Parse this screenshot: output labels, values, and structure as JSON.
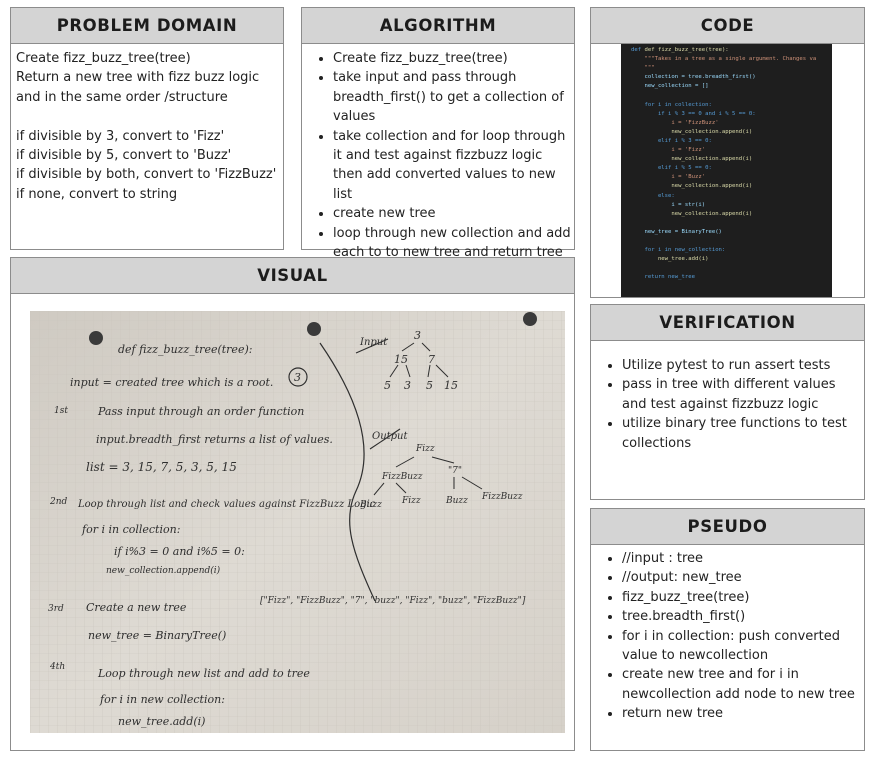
{
  "problem_domain": {
    "title": "PROBLEM DOMAIN",
    "lines": [
      "Create fizz_buzz_tree(tree)",
      "Return a new tree with fizz buzz logic",
      "and in the same order /structure",
      "",
      "if divisible by 3, convert to 'Fizz'",
      "if divisible by 5, convert to 'Buzz'",
      "if divisible by both, convert to 'FizzBuzz'",
      "if none, convert to string"
    ]
  },
  "algorithm": {
    "title": "ALGORITHM",
    "items": [
      "Create fizz_buzz_tree(tree)",
      "take input and pass through breadth_first() to get a collection of values",
      "take collection and for loop through it and test against fizzbuzz logic then add converted values to new list",
      "create new tree",
      "loop through new collection and add each to to new tree and return tree"
    ]
  },
  "code": {
    "title": "CODE",
    "lines": [
      "def fizz_buzz_tree(tree):",
      "    \"\"\"Takes in a tree as a single argument. Changes va",
      "    \"\"\"",
      "    collection = tree.breadth_first()",
      "    new_collection = []",
      "",
      "    for i in collection:",
      "        if i % 3 == 0 and i % 5 == 0:",
      "            i = 'FizzBuzz'",
      "            new_collection.append(i)",
      "        elif i % 3 == 0:",
      "            i = 'Fizz'",
      "            new_collection.append(i)",
      "        elif i % 5 == 0:",
      "            i = 'Buzz'",
      "            new_collection.append(i)",
      "        else:",
      "            i = str(i)",
      "            new_collection.append(i)",
      "",
      "    new_tree = BinaryTree()",
      "",
      "    for i in new_collection:",
      "        new_tree.add(i)",
      "",
      "    return new_tree"
    ]
  },
  "verification": {
    "title": "VERIFICATION",
    "items": [
      "Utilize pytest to run assert tests",
      "pass in tree with different values and test against fizzbuzz logic",
      "utilize binary tree functions to test collections"
    ]
  },
  "pseudo": {
    "title": "PSEUDO",
    "items": [
      "//input : tree",
      "//output: new_tree",
      "fizz_buzz_tree(tree)",
      "tree.breadth_first()",
      "for i in collection: push converted value to newcollection",
      "create new tree and for i in newcollection add node to new tree",
      "return new tree"
    ]
  },
  "visual": {
    "title": "VISUAL",
    "notes": [
      "def fizz_buzz_tree(tree):",
      "input = created tree which is a root.",
      "3",
      "1st",
      "Pass input through an order function",
      "input.breadth_first returns a list of values.",
      "list = 3, 15, 7, 5, 3, 5, 15",
      "2nd",
      "Loop through list and check values against FizzBuzz Logic",
      "for i in collection:",
      "if i%3 = 0 and i%5 = 0:",
      "new_collection.append(i)",
      "3rd",
      "Create a new tree",
      "new_tree = BinaryTree()",
      "[\"Fizz\", \"FizzBuzz\", \"7\", \"buzz\", \"Fizz\", \"buzz\", \"FizzBuzz\"]",
      "4th",
      "Loop through new list and add to tree",
      "for i in new collection:",
      "new_tree.add(i)",
      "Input",
      "Output"
    ],
    "input_tree": [
      "3",
      "15",
      "7",
      "5",
      "3",
      "5",
      "15"
    ],
    "output_tree": [
      "Fizz",
      "FizzBuzz",
      "\"7\"",
      "Buzz",
      "Fizz",
      "Buzz",
      "FizzBuzz"
    ]
  }
}
